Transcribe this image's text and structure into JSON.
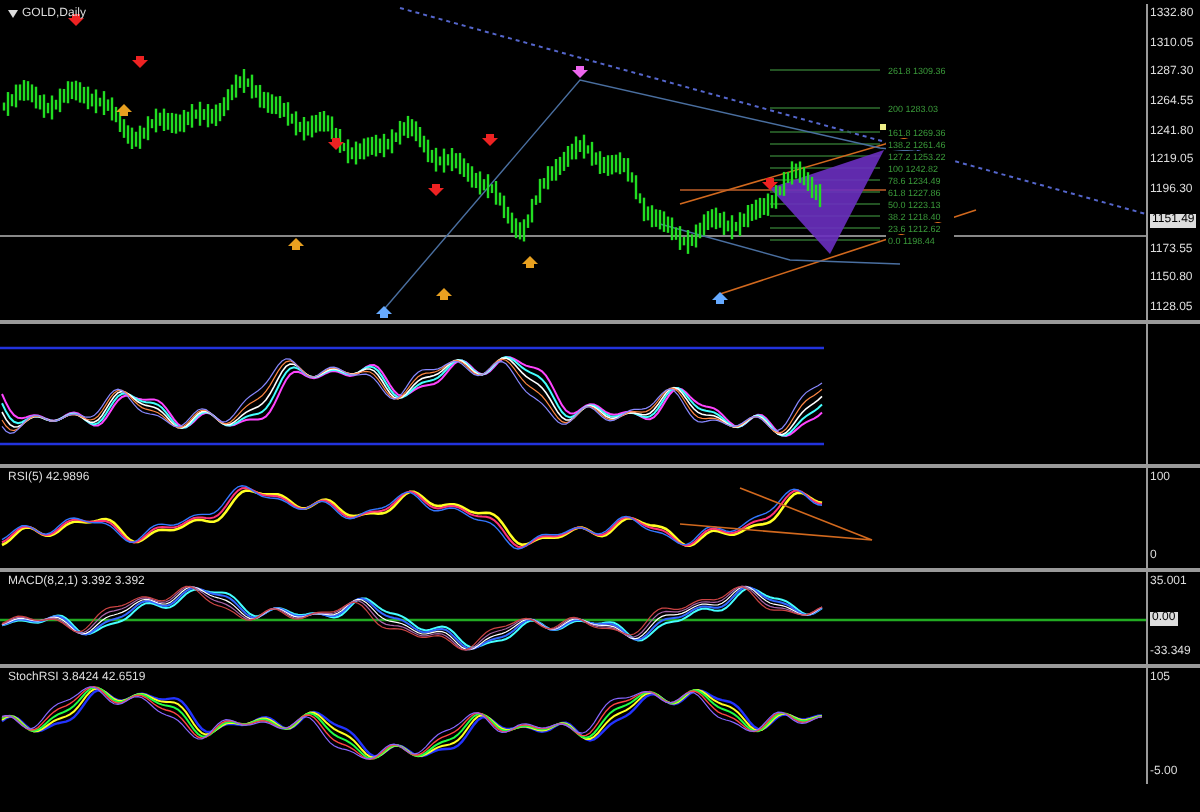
{
  "chart": {
    "title": "GOLD,Daily",
    "price_axis": [
      {
        "value": "1332.80",
        "current": false
      },
      {
        "value": "1310.05",
        "current": false
      },
      {
        "value": "1287.30",
        "current": false
      },
      {
        "value": "1264.55",
        "current": false
      },
      {
        "value": "1241.80",
        "current": false
      },
      {
        "value": "1219.05",
        "current": false
      },
      {
        "value": "1196.30",
        "current": false
      },
      {
        "value": "1151.49",
        "current": true
      },
      {
        "value": "1173.55",
        "current": false
      },
      {
        "value": "1150.80",
        "current": false
      },
      {
        "value": "1128.05",
        "current": false
      }
    ],
    "fib_levels": [
      "261.8  1309.36",
      "200  1283.03",
      "161.8  1269.36",
      "138.2  1261.46",
      "127.2  1253.22",
      "100  1242.82",
      "78.6  1234.49",
      "61.8  1227.86",
      "50.0  1223.13",
      "38.2  1218.40",
      "23.6  1212.62",
      "0.0  1198.44"
    ]
  },
  "indicators": [
    {
      "kind": "bands"
    },
    {
      "kind": "rsi",
      "label": "RSI(5) 42.9896",
      "axis": [
        {
          "value": "100",
          "current": false
        },
        {
          "value": "0",
          "current": false
        }
      ]
    },
    {
      "kind": "macd",
      "label": "MACD(8,2,1) 3.392 3.392",
      "axis": [
        {
          "value": "35.001",
          "current": false
        },
        {
          "value": "0.00",
          "current": true
        },
        {
          "value": "-33.349",
          "current": false
        }
      ]
    },
    {
      "kind": "stoch",
      "label": "StochRSI 3.8424 42.6519",
      "axis": [
        {
          "value": "105",
          "current": false
        },
        {
          "value": "-5.00",
          "current": false
        }
      ]
    }
  ]
}
